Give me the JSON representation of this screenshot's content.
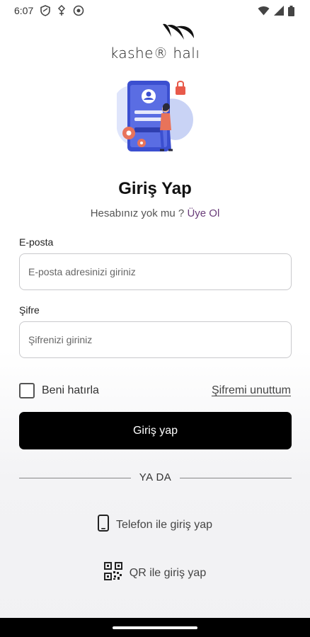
{
  "status_bar": {
    "time": "6:07",
    "icons_left": [
      "shield-icon",
      "vpn-icon",
      "cloud-icon"
    ],
    "icons_right": [
      "wifi-icon",
      "signal-icon",
      "battery-icon"
    ]
  },
  "brand": {
    "name": "kashe® halı",
    "logo_icon": "brush-swoosh-icon"
  },
  "hero": {
    "illustration": "phone-login-illustration"
  },
  "heading": {
    "title": "Giriş Yap",
    "subtitle_prefix": "Hesabınız yok mu ? ",
    "subtitle_link": "Üye Ol"
  },
  "form": {
    "email_label": "E-posta",
    "email_placeholder": "E-posta adresinizi giriniz",
    "email_value": "",
    "password_label": "Şifre",
    "password_placeholder": "Şifrenizi giriniz",
    "password_value": "",
    "remember_label": "Beni hatırla",
    "remember_checked": false,
    "forgot_label": "Şifremi unuttum",
    "submit_label": "Giriş yap"
  },
  "divider_text": "YA DA",
  "alternatives": {
    "phone_label": "Telefon ile giriş yap",
    "phone_icon": "smartphone-icon",
    "qr_label": "QR ile giriş yap",
    "qr_icon": "qr-code-icon"
  },
  "colors": {
    "primary_button": "#000000",
    "link_accent": "#6a3d7a",
    "illustration_blue": "#4a5bd8"
  }
}
